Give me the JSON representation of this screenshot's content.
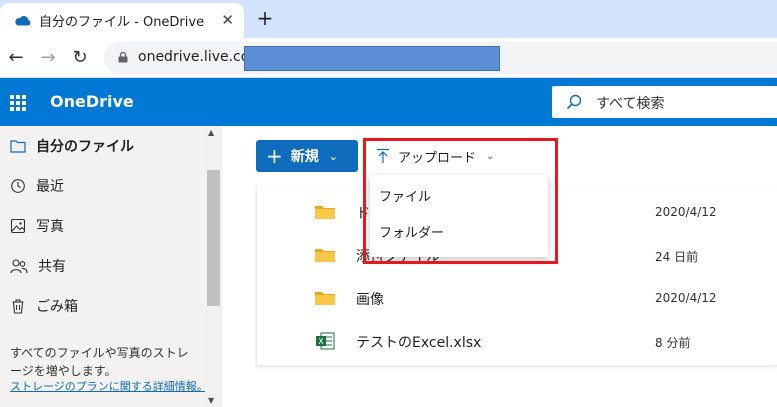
{
  "browser": {
    "tab_title": "自分のファイル - OneDrive",
    "close_glyph": "✕",
    "new_tab_glyph": "+",
    "back_glyph": "←",
    "forward_glyph": "→",
    "reload_glyph": "↻",
    "url": "onedrive.live.com"
  },
  "header": {
    "brand": "OneDrive",
    "search_placeholder": "すべて検索"
  },
  "sidebar": {
    "items": [
      {
        "label": "自分のファイル",
        "icon": "folder-icon",
        "active": true
      },
      {
        "label": "最近",
        "icon": "clock-icon"
      },
      {
        "label": "写真",
        "icon": "photo-icon"
      },
      {
        "label": "共有",
        "icon": "people-icon"
      },
      {
        "label": "ごみ箱",
        "icon": "trash-icon"
      }
    ],
    "promo_text": "すべてのファイルや写真のストレージを増やします。",
    "promo_link": "ストレージのプランに関する詳細情報。"
  },
  "commands": {
    "new_label": "新規",
    "upload_label": "アップロード"
  },
  "upload_menu": {
    "items": [
      "ファイル",
      "フォルダー"
    ]
  },
  "files": [
    {
      "name": "ド",
      "modified": "2020/4/12",
      "type": "folder"
    },
    {
      "name": "添付ファイル",
      "modified": "24 日前",
      "type": "folder"
    },
    {
      "name": "画像",
      "modified": "2020/4/12",
      "type": "folder"
    },
    {
      "name": "テストのExcel.xlsx",
      "modified": "8 分前",
      "type": "excel"
    }
  ],
  "colors": {
    "brand_blue": "#0078d4",
    "button_blue": "#0f6cbd",
    "highlight_red": "#e8181e",
    "folder_yellow": "#f8c846",
    "excel_green": "#1d6f42"
  }
}
